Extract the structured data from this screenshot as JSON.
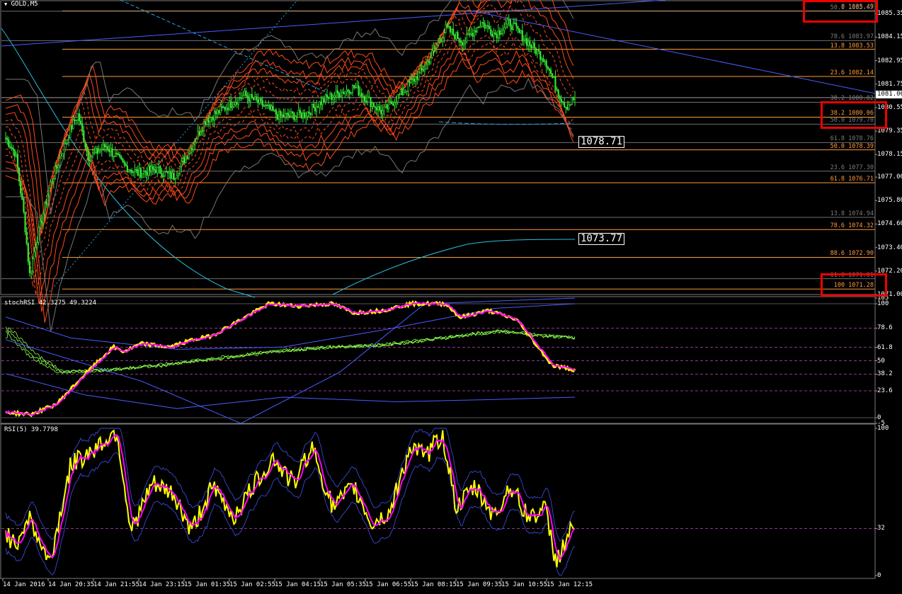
{
  "colors": {
    "background": "#000000",
    "candle": "#35e635",
    "envelope": "#ff4a1a",
    "fib": "#ff9a3c",
    "fib_dim": "#6f6f6f",
    "trend": "#4a5cff",
    "dotted": "#2aa5e8",
    "cyan": "#2bbde0",
    "stoch_main": "#ff00ff",
    "stoch_signal": "#ffee00",
    "stoch_bands": "#8aff4a",
    "rsi_main": "#ffff00",
    "rsi_signal": "#ff00ff",
    "rsi_bands": "#3a48d8",
    "level_line": "#8b3a8b"
  },
  "window": {
    "symbol_title": "GOLD,M5",
    "menu_icon": "triangle-down-icon"
  },
  "main_pane": {
    "y_ticks": [
      "1085.35",
      "1084.15",
      "1082.95",
      "1081.75",
      "1080.55",
      "1079.35",
      "1078.15",
      "1077.00",
      "1075.80",
      "1074.60",
      "1073.40",
      "1072.20",
      "1071.00"
    ],
    "current_price": "1081.06",
    "price_boxes": [
      "1078.71",
      "1073.77"
    ],
    "fib_labels": [
      {
        "text": "0 1085.49",
        "tone": "fib"
      },
      {
        "text": "50.0 1085.47",
        "tone": "dim"
      },
      {
        "text": "78.6 1083.97",
        "tone": "dim"
      },
      {
        "text": "13.8 1083.53",
        "tone": "fib"
      },
      {
        "text": "23.6 1082.14",
        "tone": "fib"
      },
      {
        "text": "38.2 1080.82",
        "tone": "dim"
      },
      {
        "text": "38.2 1080.06",
        "tone": "fib"
      },
      {
        "text": "50.0 1079.70",
        "tone": "dim"
      },
      {
        "text": "61.8 1078.76",
        "tone": "dim"
      },
      {
        "text": "50.0 1078.39",
        "tone": "fib"
      },
      {
        "text": "23.6 1077.30",
        "tone": "dim"
      },
      {
        "text": "61.8 1076.71",
        "tone": "fib"
      },
      {
        "text": "13.8 1074.94",
        "tone": "dim"
      },
      {
        "text": "78.6 1074.32",
        "tone": "fib"
      },
      {
        "text": "88.6 1072.90",
        "tone": "fib"
      },
      {
        "text": "61.8 1071.81",
        "tone": "dim"
      },
      {
        "text": "100 1071.28",
        "tone": "fib"
      }
    ]
  },
  "stoch_pane": {
    "title": "stochRSI 42.3275 49.3224",
    "y_ticks": [
      "105",
      "100",
      "78.6",
      "61.8",
      "50",
      "38.2",
      "23.6",
      "0",
      "-5"
    ]
  },
  "rsi_pane": {
    "title": "RSI(5) 39.7798",
    "y_ticks": [
      "100",
      "32",
      "0"
    ]
  },
  "x_axis": {
    "labels": [
      "14 Jan 2016",
      "14 Jan 20:35",
      "14 Jan 21:55",
      "14 Jan 23:15",
      "15 Jan 01:35",
      "15 Jan 02:55",
      "15 Jan 04:15",
      "15 Jan 05:35",
      "15 Jan 06:55",
      "15 Jan 08:15",
      "15 Jan 09:35",
      "15 Jan 10:55",
      "15 Jan 12:15"
    ]
  },
  "chart_data": [
    {
      "type": "line",
      "title": "GOLD,M5",
      "price_range": [
        1071.0,
        1085.9
      ],
      "anchors": {
        "x": [
          "14 Jan 2016",
          "14 Jan 20:35",
          "14 Jan 21:55",
          "14 Jan 23:15",
          "15 Jan 01:35",
          "15 Jan 02:55",
          "15 Jan 04:15",
          "15 Jan 05:35",
          "15 Jan 06:55",
          "15 Jan 08:15",
          "15 Jan 09:35",
          "15 Jan 10:55",
          "15 Jan 12:15"
        ],
        "close": [
          1080.9,
          1072.1,
          1080.1,
          1078.4,
          1077.4,
          1077.6,
          1080.2,
          1081.3,
          1080.3,
          1083.6,
          1084.9,
          1082.9,
          1081.06
        ]
      },
      "fib_levels": [
        1085.49,
        1085.47,
        1083.97,
        1083.53,
        1082.14,
        1080.82,
        1080.06,
        1079.7,
        1078.76,
        1078.39,
        1077.3,
        1076.71,
        1074.94,
        1074.32,
        1072.9,
        1071.81,
        1071.28
      ],
      "horizontal_levels": [
        1078.71,
        1073.77
      ],
      "current": 1081.06
    },
    {
      "type": "line",
      "title": "stochRSI 42.3275 49.3224",
      "ylim": [
        -5,
        105
      ],
      "levels": [
        78.6,
        61.8,
        50,
        38.2,
        23.6
      ],
      "series": [
        {
          "name": "stochRSI",
          "last": 42.3275
        },
        {
          "name": "signal",
          "last": 49.3224
        }
      ]
    },
    {
      "type": "line",
      "title": "RSI(5) 39.7798",
      "ylim": [
        0,
        100
      ],
      "levels": [
        32
      ],
      "series": [
        {
          "name": "RSI(5)",
          "last": 39.7798
        }
      ]
    }
  ]
}
